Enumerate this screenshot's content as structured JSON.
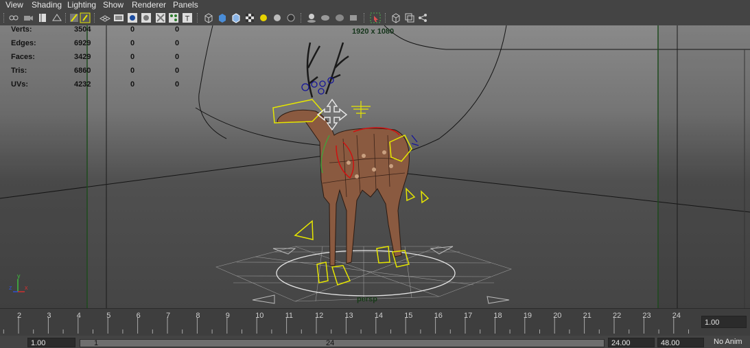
{
  "menu": [
    "View",
    "Shading",
    "Lighting",
    "Show",
    "Renderer",
    "Panels"
  ],
  "toolbar_icons": [
    "select-camera-icon",
    "camera-attributes-icon",
    "bookmarks-icon",
    "image-plane-icon",
    "film-gate-icon",
    "resolution-gate-icon",
    "grid-icon",
    "field-chart-icon",
    "safe-action-icon",
    "safe-title-icon",
    "isolate-select-icon",
    "xray-icon",
    "text-icon",
    "wireframe-icon",
    "smooth-shade-icon",
    "use-default-material-icon",
    "shade-all-icon",
    "textured-icon",
    "use-all-lights-icon",
    "shadows-icon",
    "sphere-light-icon",
    "sphere-dark-icon",
    "ambient-occlusion-icon",
    "motion-blur-icon",
    "multisample-icon",
    "depth-of-field-icon",
    "isolate-view-icon",
    "single-pane-icon",
    "four-pane-icon",
    "share-icon"
  ],
  "hud": {
    "rows": [
      {
        "label": "Verts:",
        "v1": "3504",
        "v2": "0",
        "v3": "0"
      },
      {
        "label": "Edges:",
        "v1": "6929",
        "v2": "0",
        "v3": "0"
      },
      {
        "label": "Faces:",
        "v1": "3429",
        "v2": "0",
        "v3": "0"
      },
      {
        "label": "Tris:",
        "v1": "6860",
        "v2": "0",
        "v3": "0"
      },
      {
        "label": "UVs:",
        "v1": "4232",
        "v2": "0",
        "v3": "0"
      }
    ],
    "resolution": "1920 x 1080",
    "camera": "persp",
    "axis_labels": {
      "y": "y",
      "z": "z",
      "x": "x"
    }
  },
  "timeline": {
    "ticks": [
      "2",
      "3",
      "4",
      "5",
      "6",
      "7",
      "8",
      "9",
      "10",
      "11",
      "12",
      "13",
      "14",
      "15",
      "16",
      "17",
      "18",
      "19",
      "20",
      "21",
      "22",
      "23",
      "24"
    ],
    "current_frame": "1.00"
  },
  "range": {
    "start": "1.00",
    "slider_min": "1",
    "slider_max": "24",
    "end": "24.00",
    "anim_end": "48.00",
    "anim_layer": "No Anim"
  },
  "colors": {
    "hud_text": "#111111",
    "selection_yellow": "#e6e600",
    "wire_dark": "#141414",
    "mesh": "#8a5a40"
  }
}
